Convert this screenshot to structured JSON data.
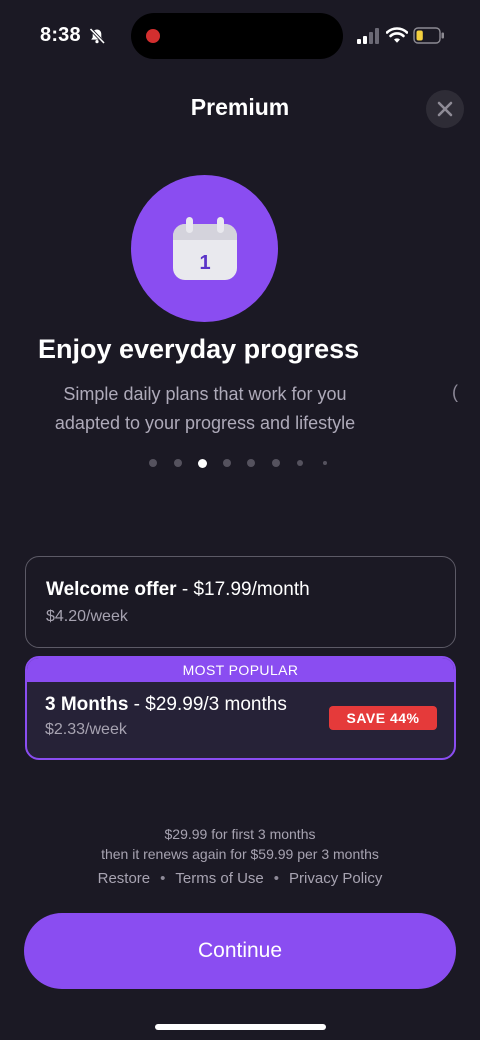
{
  "status_bar": {
    "time": "8:38",
    "icons": [
      "bell-slash-icon",
      "signal-icon",
      "wifi-icon",
      "battery-icon"
    ],
    "battery_fraction": 0.3
  },
  "header": {
    "title": "Premium",
    "close_icon": "close-icon"
  },
  "hero": {
    "icon": "calendar-icon",
    "calendar_number": "1",
    "title": "Enjoy everyday progress",
    "subtitle_line1": "Simple daily plans that work for you",
    "subtitle_line2": "adapted to your progress and lifestyle",
    "next_slide_peek": "(",
    "page_count": 8,
    "active_page": 3
  },
  "plans": [
    {
      "name": "Welcome offer",
      "price": " - $17.99/month",
      "weekly": "$4.20/week",
      "selected": false
    },
    {
      "name": "3 Months",
      "price": " - $29.99/3 months",
      "weekly": "$2.33/week",
      "banner": "MOST POPULAR",
      "badge": "SAVE 44%",
      "selected": true
    }
  ],
  "footer": {
    "line1": "$29.99 for first 3 months",
    "line2": "then it renews again for $59.99 per 3 months",
    "links": [
      "Restore",
      "Terms of Use",
      "Privacy Policy"
    ],
    "separator": "•"
  },
  "cta": {
    "label": "Continue"
  },
  "colors": {
    "background": "#1b1924",
    "accent": "#8a4df1",
    "badge": "#e53a3a"
  }
}
